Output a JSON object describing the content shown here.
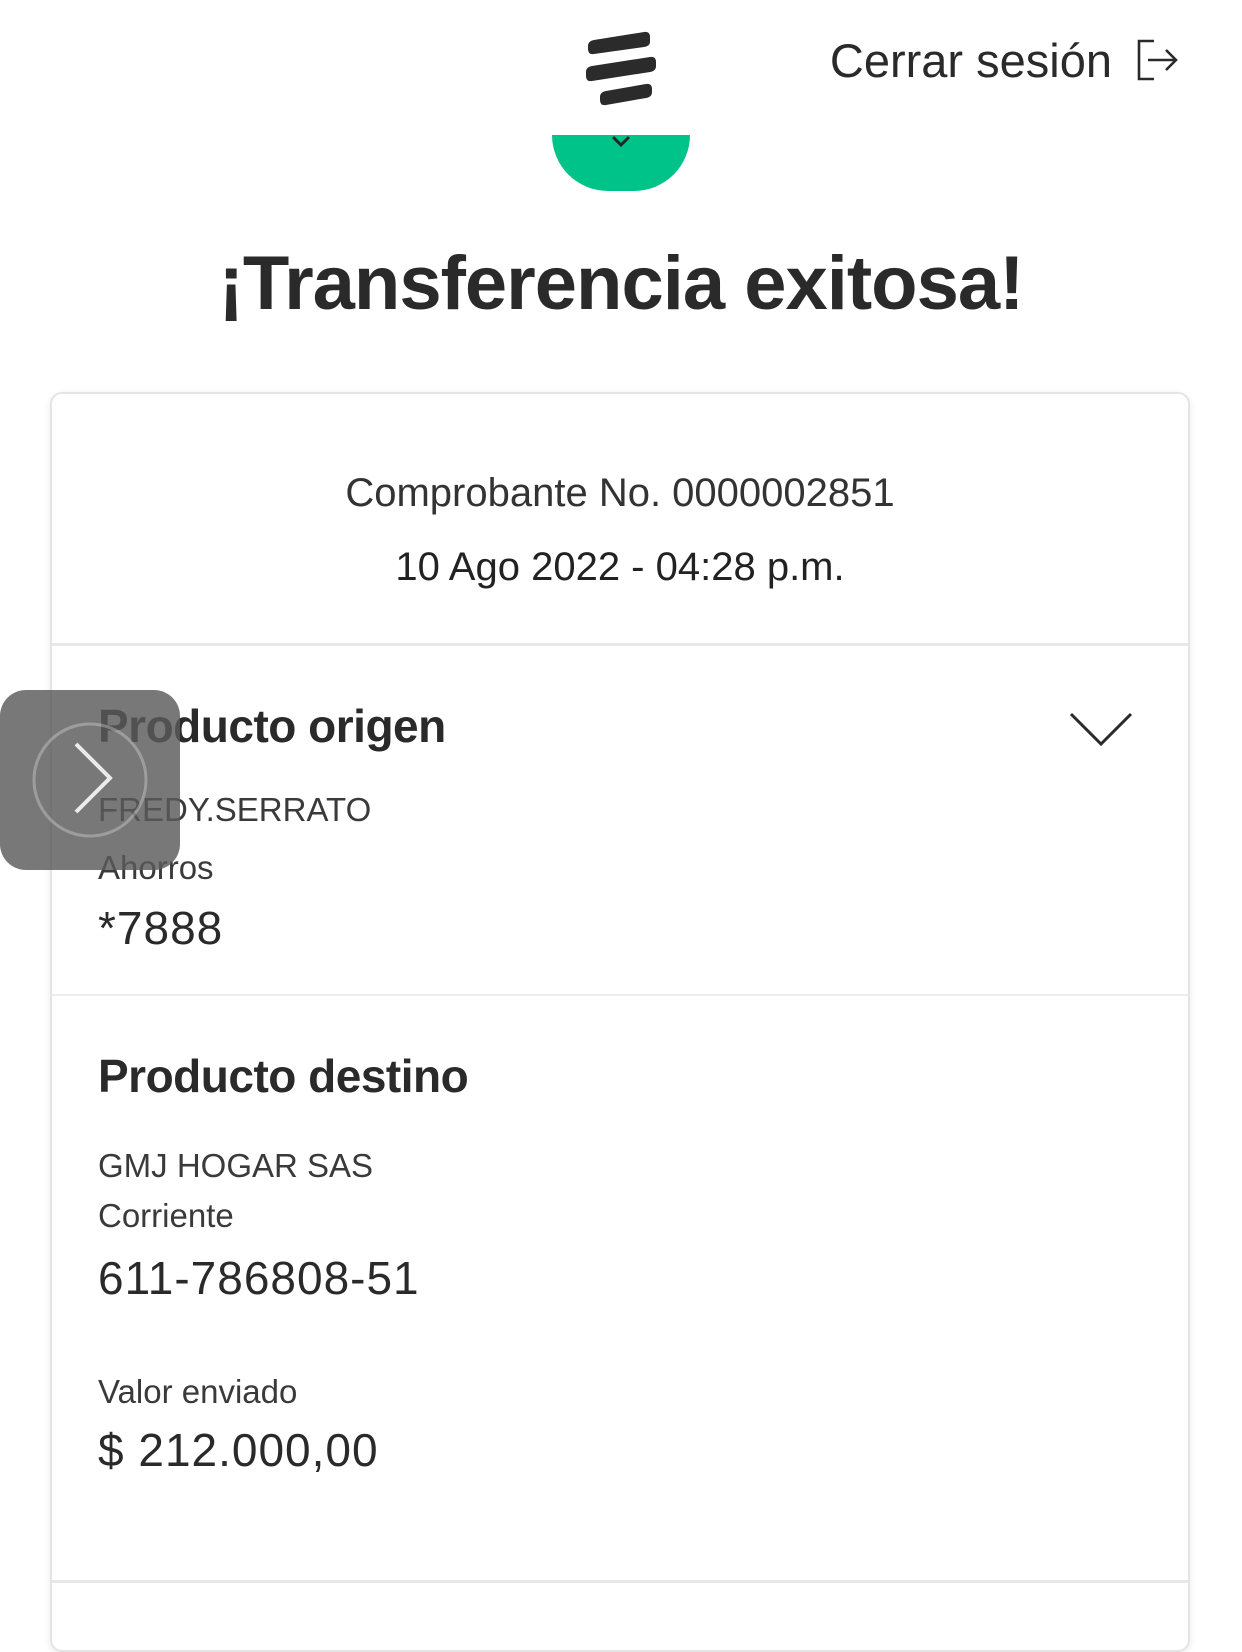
{
  "header": {
    "logo_icon": "bancolombia-logo-icon",
    "logout_label": "Cerrar sesión",
    "logout_icon": "logout-icon"
  },
  "status": {
    "icon": "success-check-icon",
    "color": "#00c389",
    "title": "¡Transferencia exitosa!"
  },
  "receipt": {
    "number": "Comprobante No. 0000002851",
    "datetime": "10 Ago 2022 - 04:28 p.m."
  },
  "origin": {
    "title": "Producto origen",
    "holder": "FREDY.SERRATO",
    "account_type": "Ahorros",
    "account_number": "*7888",
    "toggle_icon": "chevron-down-icon"
  },
  "destination": {
    "title": "Producto destino",
    "holder": "GMJ HOGAR SAS",
    "account_type": "Corriente",
    "account_number": "611-786808-51",
    "amount_label": "Valor enviado",
    "amount": "$ 212.000,00"
  },
  "overlay": {
    "icon": "chevron-right-icon"
  }
}
